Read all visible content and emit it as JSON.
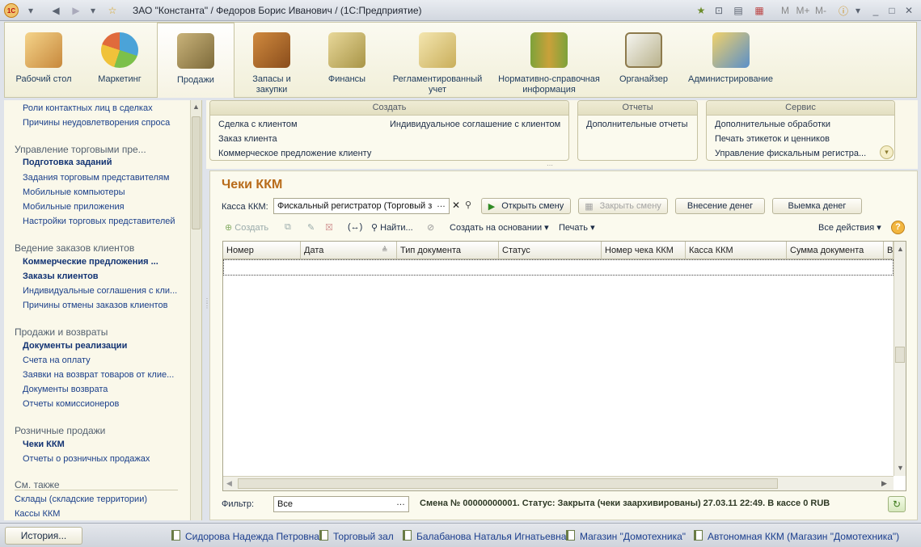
{
  "window": {
    "title": "ЗАО \"Константа\" / Федоров Борис Иванович / (1С:Предприятие)",
    "toolbar_right": {
      "m": "M",
      "mplus": "M+",
      "mminus": "M-"
    }
  },
  "sections": [
    {
      "label": "Рабочий стол",
      "icon": "desk-icon"
    },
    {
      "label": "Маркетинг",
      "icon": "pie-chart-icon"
    },
    {
      "label": "Продажи",
      "icon": "truck-icon",
      "active": true
    },
    {
      "label": "Запасы и закупки",
      "icon": "boxes-icon"
    },
    {
      "label": "Финансы",
      "icon": "coins-icon"
    },
    {
      "label": "Регламентированный учет",
      "icon": "ledger-icon"
    },
    {
      "label": "Нормативно-справочная информация",
      "icon": "binders-icon"
    },
    {
      "label": "Органайзер",
      "icon": "clipboard-icon"
    },
    {
      "label": "Администрирование",
      "icon": "database-icon"
    }
  ],
  "leftnav": {
    "top_items": [
      "Роли контактных лиц в сделках",
      "Причины неудовлетворения спроса"
    ],
    "group1": {
      "title": "Управление торговыми пре...",
      "items": [
        "Подготовка заданий",
        "Задания торговым представителям",
        "Мобильные компьютеры",
        "Мобильные приложения",
        "Настройки торговых представителей"
      ]
    },
    "group2": {
      "title": "Ведение заказов клиентов",
      "items": [
        "Коммерческие предложения ...",
        "Заказы клиентов",
        "Индивидуальные соглашения с кли...",
        "Причины отмены заказов клиентов"
      ]
    },
    "group3": {
      "title": "Продажи и возвраты",
      "items": [
        "Документы реализации",
        "Счета на оплату",
        "Заявки на возврат товаров от клие...",
        "Документы возврата",
        "Отчеты комиссионеров"
      ]
    },
    "group4": {
      "title": "Розничные продажи",
      "items": [
        "Чеки ККМ",
        "Отчеты о розничных продажах"
      ]
    },
    "see_also": {
      "title": "См. также",
      "items": [
        "Склады (складские территории)",
        "Кассы ККМ"
      ]
    }
  },
  "panel": {
    "create": {
      "title": "Создать",
      "items": [
        "Сделка с клиентом",
        "Заказ клиента",
        "Коммерческое предложение клиенту",
        "Индивидуальное соглашение с клиентом"
      ]
    },
    "reports": {
      "title": "Отчеты",
      "items": [
        "Дополнительные отчеты"
      ]
    },
    "service": {
      "title": "Сервис",
      "items": [
        "Дополнительные обработки",
        "Печать этикеток и ценников",
        "Управление фискальным регистра..."
      ]
    }
  },
  "form": {
    "title": "Чеки ККМ",
    "kassa_label": "Касса ККМ:",
    "kassa_value": "Фискальный регистратор (Торговый з",
    "btn_open": "Открыть смену",
    "btn_close": "Закрыть смену",
    "btn_deposit": "Внесение денег",
    "btn_withdraw": "Выемка денег",
    "toolbar": {
      "create": "Создать",
      "find": "Найти...",
      "create_based": "Создать на основании",
      "print": "Печать",
      "all_actions": "Все действия"
    },
    "columns": [
      "Номер",
      "Дата",
      "Тип документа",
      "Статус",
      "Номер чека ККМ",
      "Касса ККМ",
      "Сумма документа",
      "В"
    ],
    "filter_label": "Фильтр:",
    "filter_value": "Все",
    "status_line": "Смена № 00000000001. Статус: Закрыта (чеки заархивированы) 27.03.11 22:49. В кассе 0 RUB"
  },
  "bottombar": {
    "history": "История...",
    "links": [
      "Сидорова Надежда Петровна",
      "Торговый зал",
      "Балабанова Наталья Игнатьевна",
      "Магазин \"Домотехника\"",
      "Автономная ККМ (Магазин \"Домотехника\")"
    ]
  },
  "colors": {
    "accent_title": "#b86b1a",
    "link": "#1a3f8a",
    "panel_bg": "#faf8ea"
  }
}
